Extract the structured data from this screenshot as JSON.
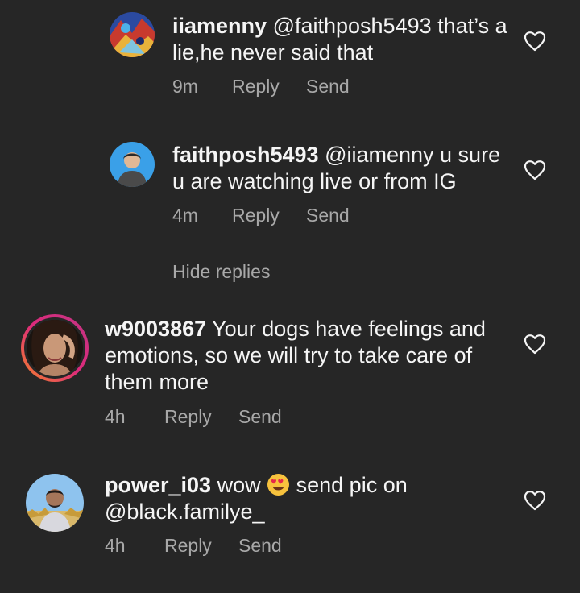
{
  "comments": [
    {
      "username": "iiamenny",
      "text": "@faithposh5493 that’s a lie,he never said that",
      "time": "9m",
      "reply": "Reply",
      "send": "Send"
    },
    {
      "username": "faithposh5493",
      "text": "@iiamenny u sure u are watching live or from IG",
      "time": "4m",
      "reply": "Reply",
      "send": "Send"
    },
    {
      "username": "w9003867",
      "text": "Your dogs have feelings and emotions, so we will try to take care of them more",
      "time": "4h",
      "reply": "Reply",
      "send": "Send"
    },
    {
      "username": "power_i03",
      "text_before_emoji": "wow",
      "emoji": "heart-eyes-emoji",
      "text_after_emoji": "send pic on @black.familye_",
      "time": "4h",
      "reply": "Reply",
      "send": "Send"
    }
  ],
  "hide_replies": "Hide replies",
  "icons": {
    "like": "heart-outline-icon"
  },
  "colors": {
    "background": "#262626",
    "primary_text": "#f5f5f5",
    "secondary_text": "#a8a8a8",
    "story_ring_start": "#f58529",
    "story_ring_end": "#c13584"
  }
}
